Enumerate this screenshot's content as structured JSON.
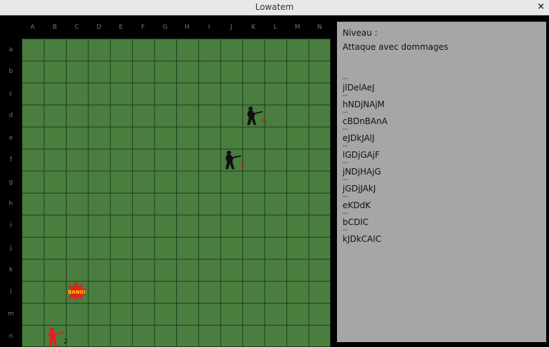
{
  "window": {
    "title": "Lowatem",
    "close_glyph": "×"
  },
  "board": {
    "columns": [
      "A",
      "B",
      "C",
      "D",
      "E",
      "F",
      "G",
      "H",
      "I",
      "J",
      "K",
      "L",
      "M",
      "N"
    ],
    "rows": [
      "a",
      "b",
      "c",
      "d",
      "e",
      "f",
      "g",
      "h",
      "i",
      "j",
      "k",
      "l",
      "m",
      "n"
    ],
    "units": [
      {
        "cell": "Kd",
        "team": "black",
        "hp": "6",
        "color": "#111111",
        "num_color": "#c8102e",
        "icon": "soldier-rifle-icon"
      },
      {
        "cell": "Jf",
        "team": "black",
        "hp": "3",
        "color": "#111111",
        "num_color": "#c8102e",
        "icon": "soldier-rifle-icon"
      },
      {
        "cell": "Bn",
        "team": "red",
        "hp": "2",
        "color": "#e3211c",
        "num_color": "#111111",
        "icon": "soldier-rifle-icon"
      }
    ],
    "effects": [
      {
        "cell": "Cl",
        "label": "BANG!",
        "icon": "explosion-icon"
      }
    ]
  },
  "panel": {
    "level_label": "Niveau :",
    "mode": "Attaque avec dommages",
    "separator": "--",
    "log": [
      "jlDelAeJ",
      "hNDjNAjM",
      "cBDnBAnA",
      "eJDkJAlJ",
      "lGDjGAjF",
      "jNDjHAjG",
      "jGDjJAkJ",
      "eKDdK",
      "bCDlC",
      "kJDkCAlC"
    ]
  },
  "colors": {
    "board": "#4a7e3f",
    "grid_line": "#1f3a1b",
    "panel": "#a6a6a6",
    "axis_text": "#5c8a52"
  }
}
